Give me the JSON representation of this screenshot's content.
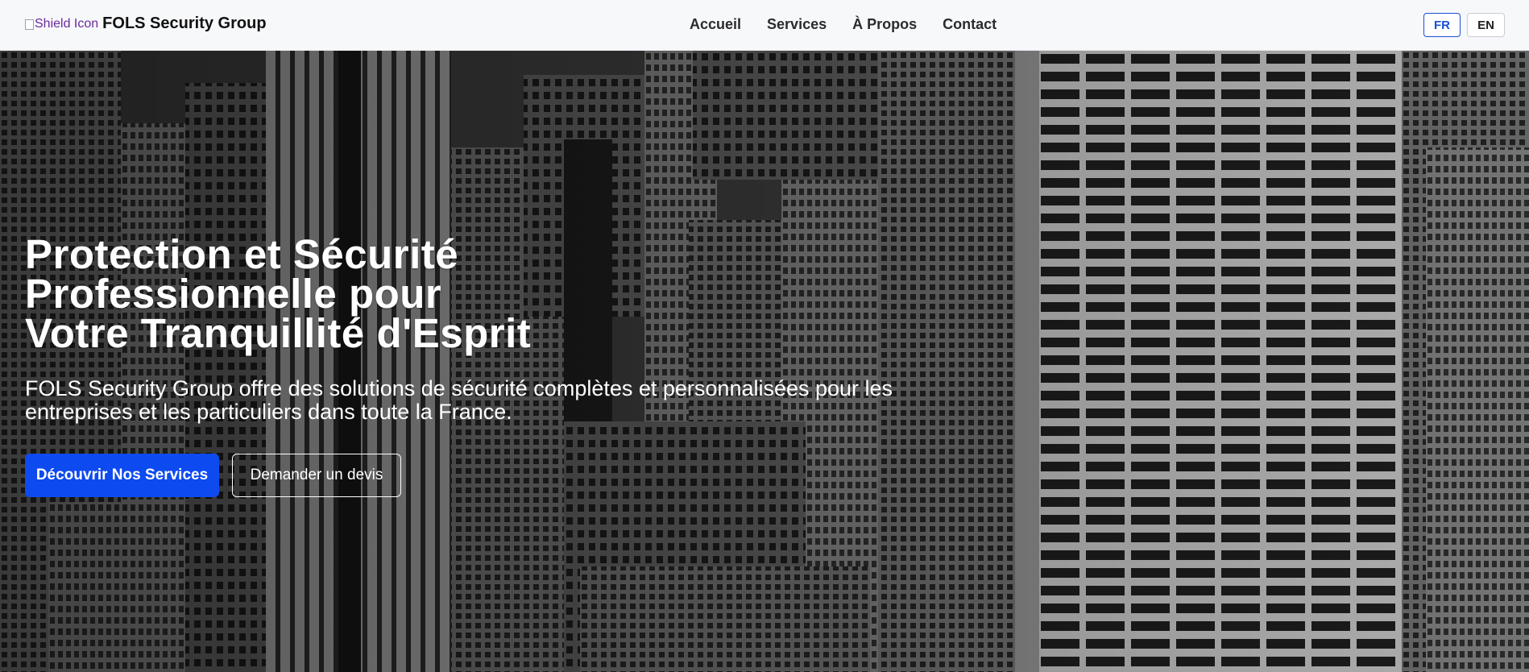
{
  "navbar": {
    "logo_alt": "Shield Icon",
    "brand_name": "FOLS Security Group",
    "links": [
      {
        "label": "Accueil"
      },
      {
        "label": "Services"
      },
      {
        "label": "À Propos"
      },
      {
        "label": "Contact"
      }
    ],
    "languages": [
      {
        "label": "FR",
        "active": true
      },
      {
        "label": "EN",
        "active": false
      }
    ]
  },
  "hero": {
    "title": "Protection et Sécurité\nProfessionnelle pour\nVotre Tranquillité d'Esprit",
    "subtitle": "FOLS Security Group offre des solutions de sécurité complètes et personnalisées pour les entreprises et les particuliers dans toute la France.",
    "primary_button": "Découvrir Nos Services",
    "secondary_button": "Demander un devis",
    "background_image": "city-skyline-grayscale"
  },
  "colors": {
    "accent": "#0d4af0",
    "nav_bg": "#f7f8fa"
  }
}
